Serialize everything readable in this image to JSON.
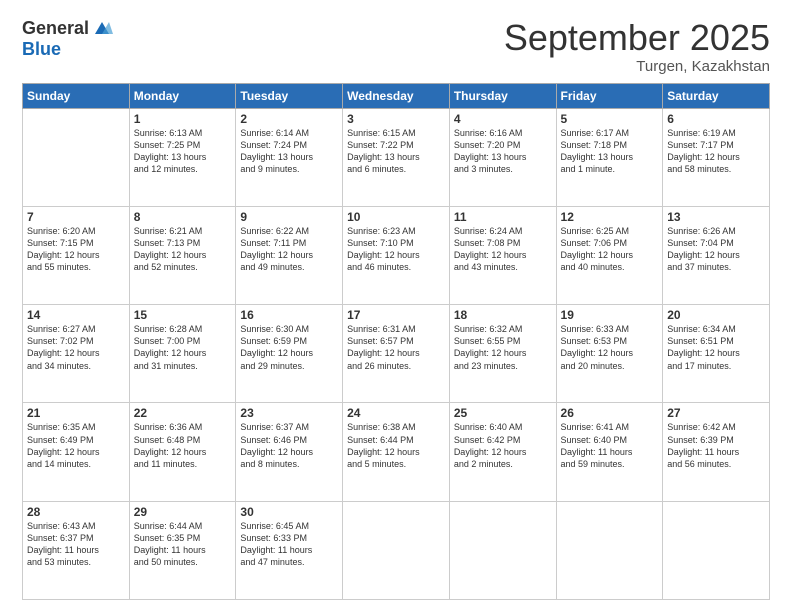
{
  "header": {
    "logo_general": "General",
    "logo_blue": "Blue",
    "month_title": "September 2025",
    "location": "Turgen, Kazakhstan"
  },
  "weekdays": [
    "Sunday",
    "Monday",
    "Tuesday",
    "Wednesday",
    "Thursday",
    "Friday",
    "Saturday"
  ],
  "weeks": [
    [
      {
        "day": "",
        "info": ""
      },
      {
        "day": "1",
        "info": "Sunrise: 6:13 AM\nSunset: 7:25 PM\nDaylight: 13 hours\nand 12 minutes."
      },
      {
        "day": "2",
        "info": "Sunrise: 6:14 AM\nSunset: 7:24 PM\nDaylight: 13 hours\nand 9 minutes."
      },
      {
        "day": "3",
        "info": "Sunrise: 6:15 AM\nSunset: 7:22 PM\nDaylight: 13 hours\nand 6 minutes."
      },
      {
        "day": "4",
        "info": "Sunrise: 6:16 AM\nSunset: 7:20 PM\nDaylight: 13 hours\nand 3 minutes."
      },
      {
        "day": "5",
        "info": "Sunrise: 6:17 AM\nSunset: 7:18 PM\nDaylight: 13 hours\nand 1 minute."
      },
      {
        "day": "6",
        "info": "Sunrise: 6:19 AM\nSunset: 7:17 PM\nDaylight: 12 hours\nand 58 minutes."
      }
    ],
    [
      {
        "day": "7",
        "info": "Sunrise: 6:20 AM\nSunset: 7:15 PM\nDaylight: 12 hours\nand 55 minutes."
      },
      {
        "day": "8",
        "info": "Sunrise: 6:21 AM\nSunset: 7:13 PM\nDaylight: 12 hours\nand 52 minutes."
      },
      {
        "day": "9",
        "info": "Sunrise: 6:22 AM\nSunset: 7:11 PM\nDaylight: 12 hours\nand 49 minutes."
      },
      {
        "day": "10",
        "info": "Sunrise: 6:23 AM\nSunset: 7:10 PM\nDaylight: 12 hours\nand 46 minutes."
      },
      {
        "day": "11",
        "info": "Sunrise: 6:24 AM\nSunset: 7:08 PM\nDaylight: 12 hours\nand 43 minutes."
      },
      {
        "day": "12",
        "info": "Sunrise: 6:25 AM\nSunset: 7:06 PM\nDaylight: 12 hours\nand 40 minutes."
      },
      {
        "day": "13",
        "info": "Sunrise: 6:26 AM\nSunset: 7:04 PM\nDaylight: 12 hours\nand 37 minutes."
      }
    ],
    [
      {
        "day": "14",
        "info": "Sunrise: 6:27 AM\nSunset: 7:02 PM\nDaylight: 12 hours\nand 34 minutes."
      },
      {
        "day": "15",
        "info": "Sunrise: 6:28 AM\nSunset: 7:00 PM\nDaylight: 12 hours\nand 31 minutes."
      },
      {
        "day": "16",
        "info": "Sunrise: 6:30 AM\nSunset: 6:59 PM\nDaylight: 12 hours\nand 29 minutes."
      },
      {
        "day": "17",
        "info": "Sunrise: 6:31 AM\nSunset: 6:57 PM\nDaylight: 12 hours\nand 26 minutes."
      },
      {
        "day": "18",
        "info": "Sunrise: 6:32 AM\nSunset: 6:55 PM\nDaylight: 12 hours\nand 23 minutes."
      },
      {
        "day": "19",
        "info": "Sunrise: 6:33 AM\nSunset: 6:53 PM\nDaylight: 12 hours\nand 20 minutes."
      },
      {
        "day": "20",
        "info": "Sunrise: 6:34 AM\nSunset: 6:51 PM\nDaylight: 12 hours\nand 17 minutes."
      }
    ],
    [
      {
        "day": "21",
        "info": "Sunrise: 6:35 AM\nSunset: 6:49 PM\nDaylight: 12 hours\nand 14 minutes."
      },
      {
        "day": "22",
        "info": "Sunrise: 6:36 AM\nSunset: 6:48 PM\nDaylight: 12 hours\nand 11 minutes."
      },
      {
        "day": "23",
        "info": "Sunrise: 6:37 AM\nSunset: 6:46 PM\nDaylight: 12 hours\nand 8 minutes."
      },
      {
        "day": "24",
        "info": "Sunrise: 6:38 AM\nSunset: 6:44 PM\nDaylight: 12 hours\nand 5 minutes."
      },
      {
        "day": "25",
        "info": "Sunrise: 6:40 AM\nSunset: 6:42 PM\nDaylight: 12 hours\nand 2 minutes."
      },
      {
        "day": "26",
        "info": "Sunrise: 6:41 AM\nSunset: 6:40 PM\nDaylight: 11 hours\nand 59 minutes."
      },
      {
        "day": "27",
        "info": "Sunrise: 6:42 AM\nSunset: 6:39 PM\nDaylight: 11 hours\nand 56 minutes."
      }
    ],
    [
      {
        "day": "28",
        "info": "Sunrise: 6:43 AM\nSunset: 6:37 PM\nDaylight: 11 hours\nand 53 minutes."
      },
      {
        "day": "29",
        "info": "Sunrise: 6:44 AM\nSunset: 6:35 PM\nDaylight: 11 hours\nand 50 minutes."
      },
      {
        "day": "30",
        "info": "Sunrise: 6:45 AM\nSunset: 6:33 PM\nDaylight: 11 hours\nand 47 minutes."
      },
      {
        "day": "",
        "info": ""
      },
      {
        "day": "",
        "info": ""
      },
      {
        "day": "",
        "info": ""
      },
      {
        "day": "",
        "info": ""
      }
    ]
  ]
}
